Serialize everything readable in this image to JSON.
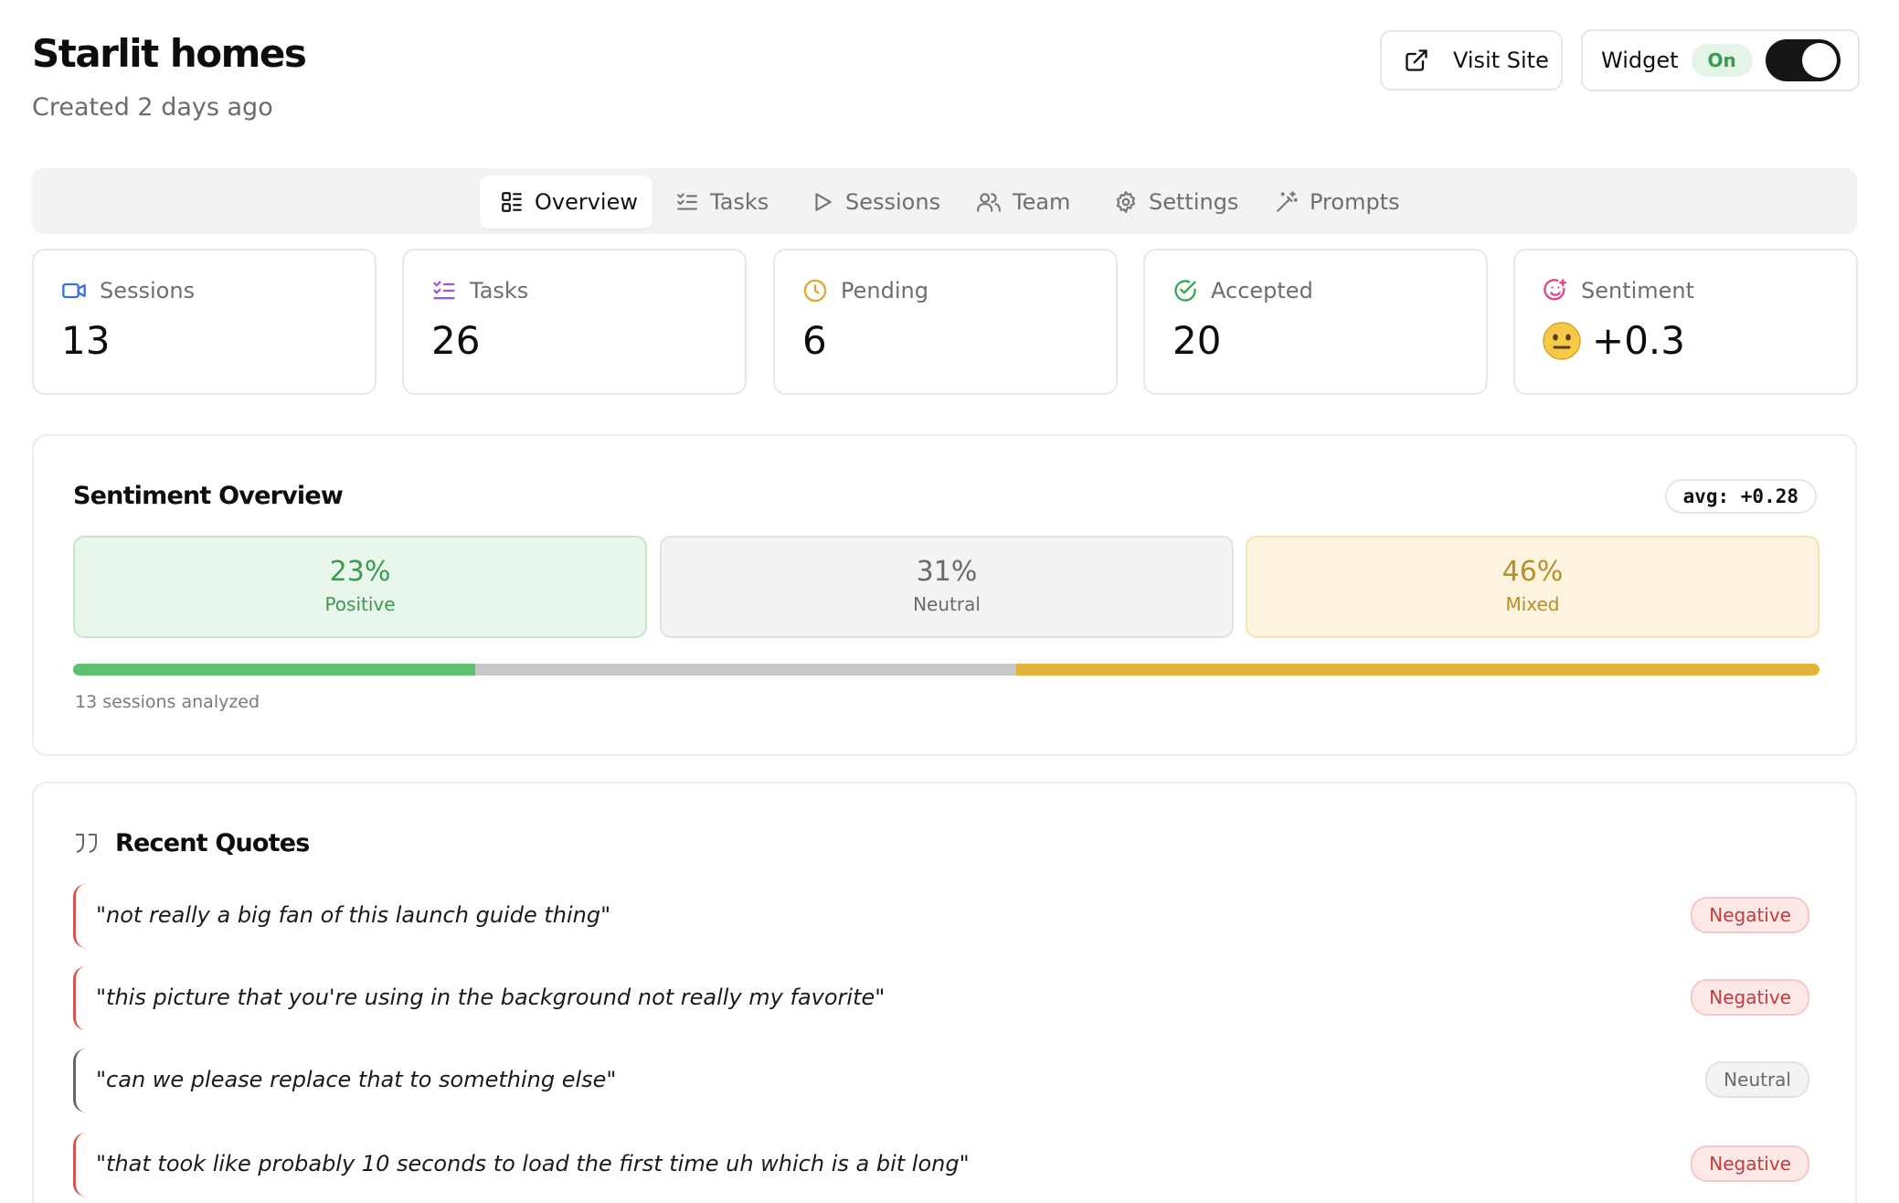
{
  "header": {
    "title": "Starlit homes",
    "subtitle": "Created 2 days ago",
    "visit_label": "Visit Site",
    "widget_label": "Widget",
    "widget_state": "On"
  },
  "tabs": [
    {
      "label": "Overview",
      "icon": "list-grid-icon",
      "active": true
    },
    {
      "label": "Tasks",
      "icon": "checklist-icon",
      "active": false
    },
    {
      "label": "Sessions",
      "icon": "play-icon",
      "active": false
    },
    {
      "label": "Team",
      "icon": "users-icon",
      "active": false
    },
    {
      "label": "Settings",
      "icon": "gear-icon",
      "active": false
    },
    {
      "label": "Prompts",
      "icon": "magic-wand-icon",
      "active": false
    }
  ],
  "stats": [
    {
      "label": "Sessions",
      "value": "13",
      "icon": "video-icon",
      "color": "#3b6fe0"
    },
    {
      "label": "Tasks",
      "value": "26",
      "icon": "checklist-icon",
      "color": "#9b59d6"
    },
    {
      "label": "Pending",
      "value": "6",
      "icon": "clock-icon",
      "color": "#e0a82e"
    },
    {
      "label": "Accepted",
      "value": "20",
      "icon": "check-circle-icon",
      "color": "#3aa655"
    },
    {
      "label": "Sentiment",
      "value": "+0.3",
      "icon": "smile-plus-icon",
      "color": "#e0468a",
      "emoji": "neutral-face-emoji"
    }
  ],
  "sentiment": {
    "title": "Sentiment Overview",
    "avg_label": "avg: +0.28",
    "segments": [
      {
        "pct": "23%",
        "label": "Positive",
        "value": 23,
        "color": "#5fc16d"
      },
      {
        "pct": "31%",
        "label": "Neutral",
        "value": 31,
        "color": "#c9c9c9"
      },
      {
        "pct": "46%",
        "label": "Mixed",
        "value": 46,
        "color": "#e2b43c"
      }
    ],
    "analyzed": "13 sessions analyzed"
  },
  "quotes": {
    "title": "Recent Quotes",
    "items": [
      {
        "text": "\"not really a big fan of this launch guide thing\"",
        "badge": "Negative"
      },
      {
        "text": "\"this picture that you're using in the background not really my favorite\"",
        "badge": "Negative"
      },
      {
        "text": "\"can we please replace that to something else\"",
        "badge": "Neutral"
      },
      {
        "text": "\"that took like probably 10 seconds to load the first time uh which is a bit long\"",
        "badge": "Negative"
      }
    ]
  }
}
